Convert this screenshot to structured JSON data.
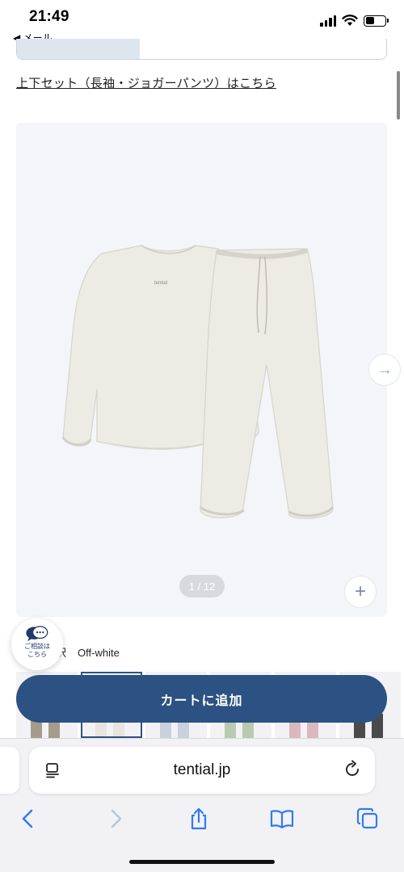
{
  "status": {
    "time": "21:49",
    "back_label": "◀ メール"
  },
  "page": {
    "set_link": "上下セット（長袖・ジョガーパンツ）はこちら",
    "gallery": {
      "page_indicator": "1 / 12",
      "plus": "+",
      "next": "→"
    },
    "color_label": "選択",
    "color_value": "Off-white",
    "chat_label_line1": "ご相談は",
    "chat_label_line2": "こちら",
    "cart_button": "カートに追加"
  },
  "browser": {
    "url": "tential.jp"
  },
  "colors": {
    "accent": "#2c5183",
    "gallery_bg": "#f4f5f8"
  },
  "icons": [
    "chevron-left-icon",
    "chevron-right-icon",
    "share-icon",
    "book-icon",
    "tabs-icon",
    "reader-icon",
    "reload-icon",
    "arrow-right-icon",
    "plus-icon",
    "chat-icon",
    "wifi-icon",
    "signal-icon",
    "battery-icon"
  ]
}
